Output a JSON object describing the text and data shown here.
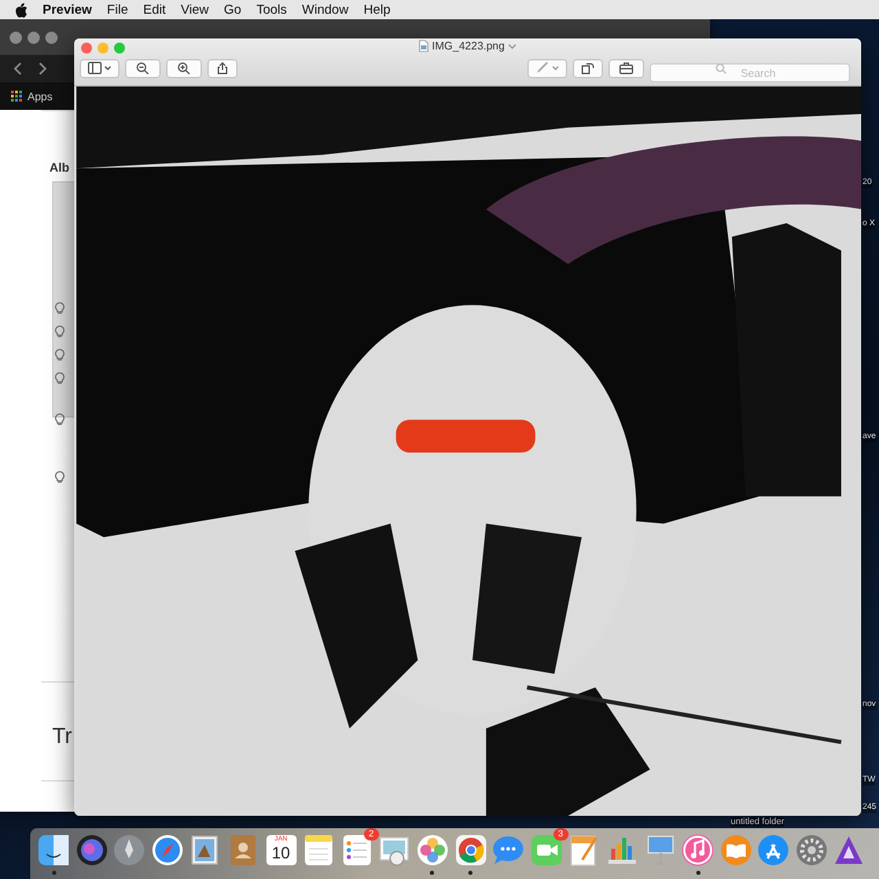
{
  "menu_bar": {
    "app": "Preview",
    "items": [
      "File",
      "Edit",
      "View",
      "Go",
      "Tools",
      "Window",
      "Help"
    ]
  },
  "browser_window": {
    "bookmark": "Apps",
    "heading": "Alb",
    "footer_text": "Tr"
  },
  "preview_window": {
    "title": "IMG_4223.png",
    "search": {
      "placeholder": "Search"
    }
  },
  "desktop": {
    "labels": [
      "20",
      "o X",
      "ave",
      "nov",
      "TW",
      "245"
    ],
    "folder": "untitled folder"
  },
  "dock": {
    "items": [
      {
        "kind": "finder",
        "running": true
      },
      {
        "kind": "siri",
        "running": false
      },
      {
        "kind": "launchpad",
        "running": false
      },
      {
        "kind": "safari",
        "running": false
      },
      {
        "kind": "stamp",
        "running": false
      },
      {
        "kind": "contacts",
        "running": false
      },
      {
        "kind": "calendar",
        "running": false,
        "month": "JAN",
        "day": "10"
      },
      {
        "kind": "notes",
        "running": false
      },
      {
        "kind": "reminders",
        "running": false,
        "badge": "2"
      },
      {
        "kind": "preview",
        "running": false
      },
      {
        "kind": "photos",
        "running": true
      },
      {
        "kind": "chrome",
        "running": true
      },
      {
        "kind": "messages",
        "running": false
      },
      {
        "kind": "facetime",
        "running": false,
        "badge": "3"
      },
      {
        "kind": "pages",
        "running": false
      },
      {
        "kind": "numbers",
        "running": false
      },
      {
        "kind": "keynote",
        "running": false
      },
      {
        "kind": "music",
        "running": true
      },
      {
        "kind": "books",
        "running": false
      },
      {
        "kind": "appstore",
        "running": false
      },
      {
        "kind": "settings",
        "running": false
      },
      {
        "kind": "other",
        "running": false
      }
    ]
  }
}
